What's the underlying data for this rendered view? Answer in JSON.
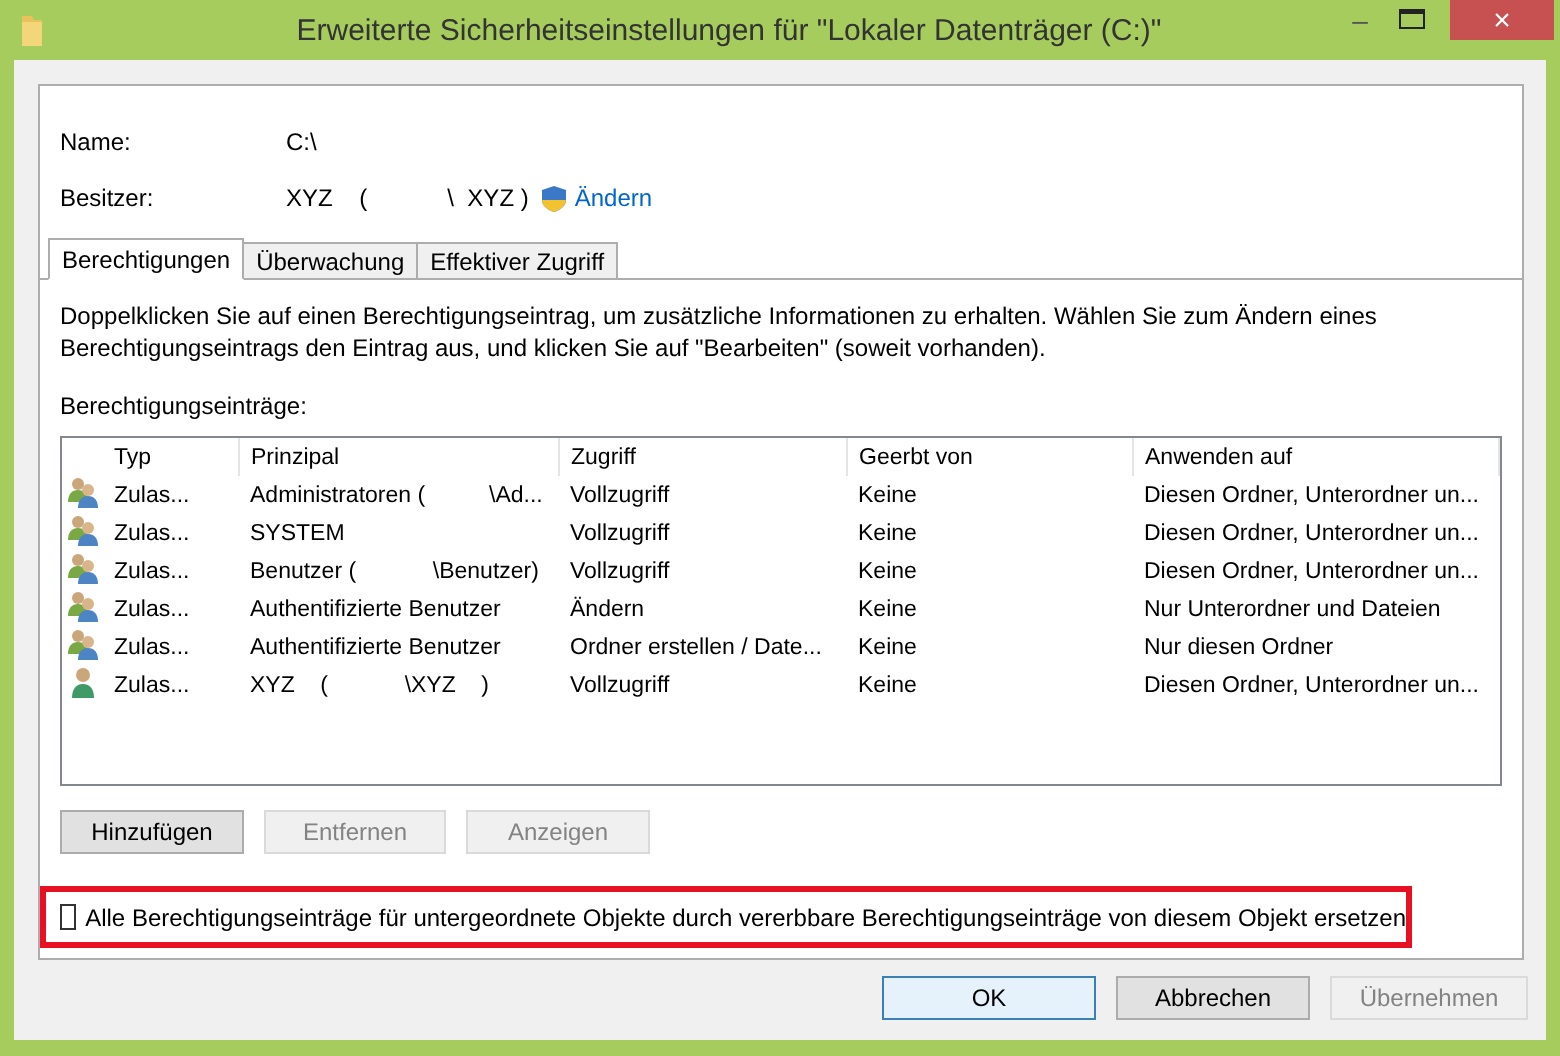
{
  "window": {
    "title": "Erweiterte Sicherheitseinstellungen für \"Lokaler Datenträger (C:)\"",
    "controls": {
      "minimize": "–",
      "close": "×"
    }
  },
  "fields": [
    {
      "label": "Name:",
      "value": "C:\\"
    },
    {
      "label": "Besitzer:",
      "value": "XYZ    (            \\  XYZ )",
      "link": "Ändern"
    }
  ],
  "tabs": [
    {
      "label": "Berechtigungen",
      "selected": true
    },
    {
      "label": "Überwachung",
      "selected": false
    },
    {
      "label": "Effektiver Zugriff",
      "selected": false
    }
  ],
  "description": "Doppelklicken Sie auf einen Berechtigungseintrag, um zusätzliche Informationen zu erhalten. Wählen Sie zum Ändern eines Berechtigungseintrags den Eintrag aus, und klicken Sie auf \"Bearbeiten\" (soweit vorhanden).",
  "list_label": "Berechtigungseinträge:",
  "table": {
    "columns": [
      "Typ",
      "Prinzipal",
      "Zugriff",
      "Geerbt von",
      "Anwenden auf"
    ],
    "rows": [
      {
        "kind": "group",
        "cells": [
          "Zulas...",
          "Administratoren (          \\Ad...",
          "Vollzugriff",
          "Keine",
          "Diesen Ordner, Unterordner un..."
        ]
      },
      {
        "kind": "group",
        "cells": [
          "Zulas...",
          "SYSTEM",
          "Vollzugriff",
          "Keine",
          "Diesen Ordner, Unterordner un..."
        ]
      },
      {
        "kind": "group",
        "cells": [
          "Zulas...",
          "Benutzer (            \\Benutzer)",
          "Vollzugriff",
          "Keine",
          "Diesen Ordner, Unterordner un..."
        ]
      },
      {
        "kind": "group",
        "cells": [
          "Zulas...",
          "Authentifizierte Benutzer",
          "Ändern",
          "Keine",
          "Nur Unterordner und Dateien"
        ]
      },
      {
        "kind": "group",
        "cells": [
          "Zulas...",
          "Authentifizierte Benutzer",
          "Ordner erstellen / Date...",
          "Keine",
          "Nur diesen Ordner"
        ]
      },
      {
        "kind": "user",
        "cells": [
          "Zulas...",
          "XYZ    (            \\XYZ    )",
          "Vollzugriff",
          "Keine",
          "Diesen Ordner, Unterordner un..."
        ]
      }
    ]
  },
  "list_buttons": [
    {
      "label": "Hinzufügen",
      "disabled": false
    },
    {
      "label": "Entfernen",
      "disabled": true
    },
    {
      "label": "Anzeigen",
      "disabled": true
    }
  ],
  "replace_checkbox": {
    "label": "Alle Berechtigungseinträge für untergeordnete Objekte durch vererbbare Berechtigungseinträge von diesem Objekt ersetzen",
    "checked": false
  },
  "dialog_buttons": [
    {
      "label": "OK",
      "disabled": false,
      "default": true
    },
    {
      "label": "Abbrechen",
      "disabled": false,
      "default": false
    },
    {
      "label": "Übernehmen",
      "disabled": true,
      "default": false
    }
  ]
}
